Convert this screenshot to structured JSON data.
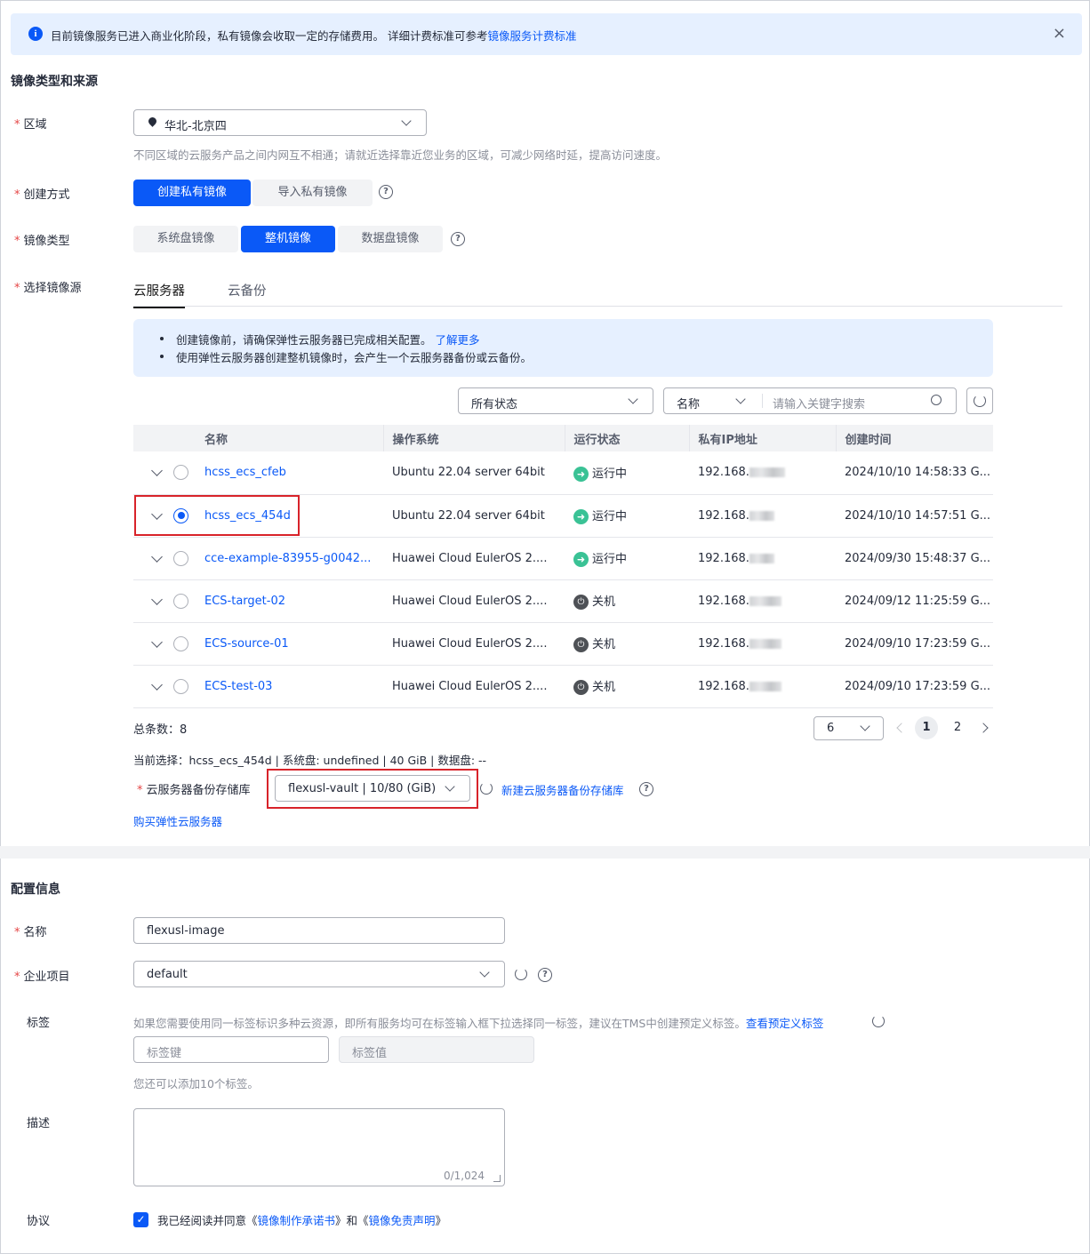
{
  "notice": {
    "text": "目前镜像服务已进入商业化阶段，私有镜像会收取一定的存储费用。 详细计费标准可参考",
    "link": "镜像服务计费标准",
    "close": "×"
  },
  "section1": {
    "title": "镜像类型和来源",
    "region_label": "区域",
    "region_value": "华北-北京四",
    "region_hint": "不同区域的云服务产品之间内网互不相通；请就近选择靠近您业务的区域，可减少网络时延，提高访问速度。",
    "create_label": "创建方式",
    "create_options": [
      "创建私有镜像",
      "导入私有镜像"
    ],
    "type_label": "镜像类型",
    "type_options": [
      "系统盘镜像",
      "整机镜像",
      "数据盘镜像"
    ],
    "source_label": "选择镜像源",
    "tabs": [
      "云服务器",
      "云备份"
    ],
    "tips": [
      "创建镜像前，请确保弹性云服务器已完成相关配置。",
      "使用弹性云服务器创建整机镜像时，会产生一个云服务器备份或云备份。"
    ],
    "tips_link": "了解更多",
    "status_filter": "所有状态",
    "search_field": "名称",
    "search_placeholder": "请输入关键字搜索"
  },
  "table": {
    "columns": [
      "名称",
      "操作系统",
      "运行状态",
      "私有IP地址",
      "创建时间"
    ],
    "rows": [
      {
        "name": "hcss_ecs_cfeb",
        "os": "Ubuntu 22.04 server 64bit",
        "status": "运行中",
        "ip": "192.168.",
        "time": "2024/10/10 14:58:33 G..."
      },
      {
        "name": "hcss_ecs_454d",
        "os": "Ubuntu 22.04 server 64bit",
        "status": "运行中",
        "ip": "192.168.",
        "time": "2024/10/10 14:57:51 G..."
      },
      {
        "name": "cce-example-83955-g0042...",
        "os": "Huawei Cloud EulerOS 2....",
        "status": "运行中",
        "ip": "192.168.",
        "time": "2024/09/30 15:48:37 G..."
      },
      {
        "name": "ECS-target-02",
        "os": "Huawei Cloud EulerOS 2....",
        "status": "关机",
        "ip": "192.168.",
        "time": "2024/09/12 11:25:59 G..."
      },
      {
        "name": "ECS-source-01",
        "os": "Huawei Cloud EulerOS 2....",
        "status": "关机",
        "ip": "192.168.",
        "time": "2024/09/10 17:23:59 G..."
      },
      {
        "name": "ECS-test-03",
        "os": "Huawei Cloud EulerOS 2....",
        "status": "关机",
        "ip": "192.168.",
        "time": "2024/09/10 17:23:59 G..."
      }
    ],
    "total": "总条数：8",
    "page_size": "6",
    "pages": [
      "1",
      "2"
    ],
    "current_selection": "当前选择：hcss_ecs_454d | 系统盘: undefined | 40 GiB | 数据盘: --"
  },
  "vault": {
    "label": "云服务器备份存储库",
    "value": "flexusl-vault | 10/80 (GiB)",
    "new_link": "新建云服务器备份存储库",
    "buy_link": "购买弹性云服务器"
  },
  "section2": {
    "title": "配置信息",
    "name_label": "名称",
    "name_value": "flexusl-image",
    "project_label": "企业项目",
    "project_value": "default",
    "tag_label": "标签",
    "tag_hint": "如果您需要使用同一标签标识多种云资源，即所有服务均可在标签输入框下拉选择同一标签，建议在TMS中创建预定义标签。",
    "tag_link": "查看预定义标签",
    "tag_key_ph": "标签键",
    "tag_val_ph": "标签值",
    "tag_remaining": "您还可以添加10个标签。",
    "desc_label": "描述",
    "desc_counter": "0/1,024",
    "agree_label": "协议",
    "agree_text1": "我已经阅读并同意《",
    "agree_link1": "镜像制作承诺书",
    "agree_text2": "》和《",
    "agree_link2": "镜像免责声明",
    "agree_text3": "》"
  },
  "colors": {
    "accent": "#0a59f7",
    "running": "#3ac295",
    "highlight": "#d8232a"
  }
}
